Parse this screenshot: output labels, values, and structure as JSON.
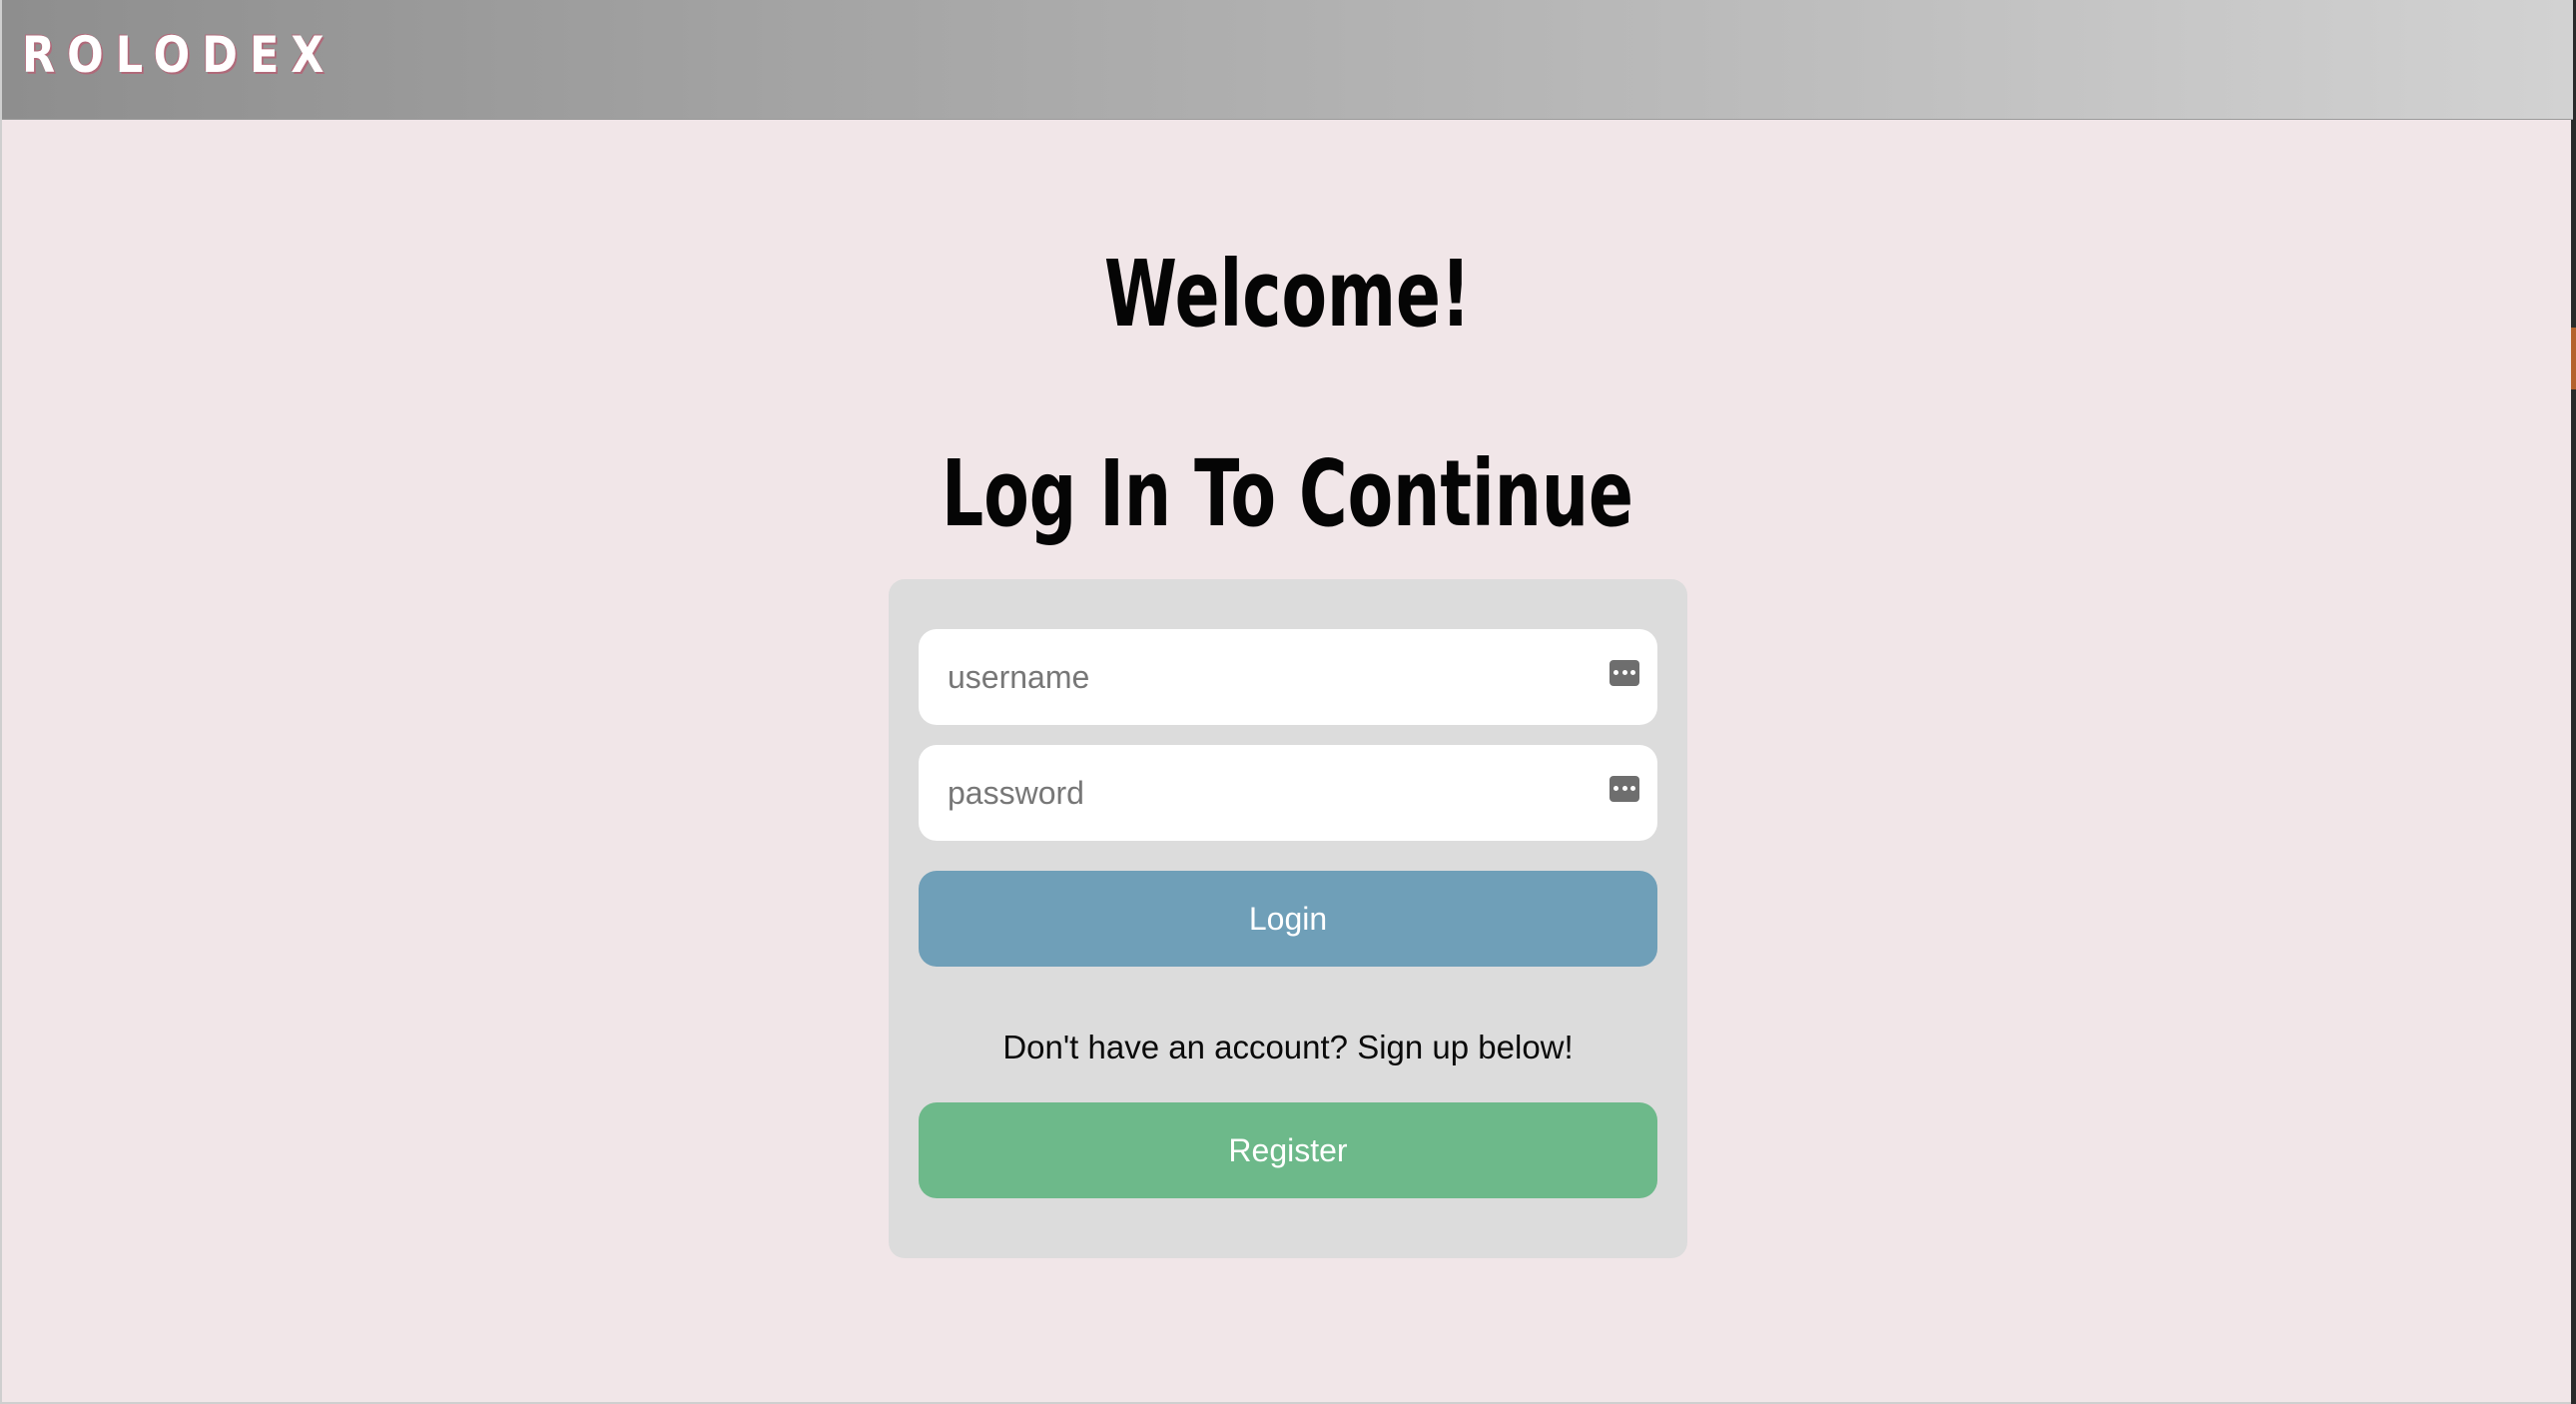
{
  "navbar": {
    "brand": "ROLODEX"
  },
  "main": {
    "welcome": "Welcome!",
    "subtitle": "Log In To Continue"
  },
  "login_form": {
    "username_placeholder": "username",
    "username_value": "",
    "password_placeholder": "password",
    "password_value": "",
    "login_label": "Login",
    "signup_prompt": "Don't have an account? Sign up below!",
    "register_label": "Register"
  },
  "icons": {
    "field_icon": "password-manager-key-icon"
  },
  "colors": {
    "background": "#f1e6e8",
    "card": "#dcdcdc",
    "login_button": "#6f9fb8",
    "register_button": "#6db98a",
    "navbar_gradient_start": "#8e8e8e",
    "navbar_gradient_end": "#d2d2d2"
  }
}
